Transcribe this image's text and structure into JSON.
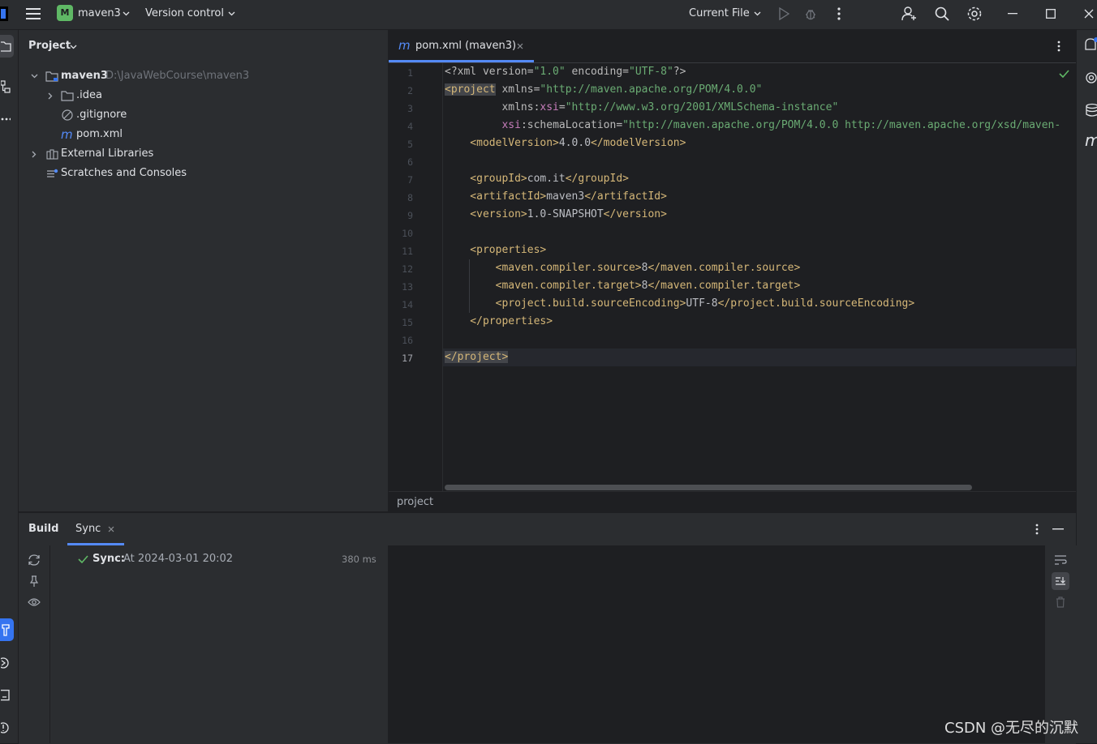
{
  "titlebar": {
    "project_badge": "M",
    "project_name": "maven3",
    "vcs_label": "Version control",
    "run_config": "Current File"
  },
  "project_panel": {
    "title": "Project",
    "tree": [
      {
        "name": "maven3",
        "path": "D:\\JavaWebCourse\\maven3"
      },
      {
        "name": ".idea"
      },
      {
        "name": ".gitignore"
      },
      {
        "name": "pom.xml"
      },
      {
        "name": "External Libraries"
      },
      {
        "name": "Scratches and Consoles"
      }
    ]
  },
  "editor": {
    "tab_label": "pom.xml (maven3)",
    "line_numbers": [
      "1",
      "2",
      "3",
      "4",
      "5",
      "6",
      "7",
      "8",
      "9",
      "10",
      "11",
      "12",
      "13",
      "14",
      "15",
      "16",
      "17"
    ],
    "breadcrumb": "project"
  },
  "build": {
    "tab_build": "Build",
    "tab_sync": "Sync",
    "sync_title": "Sync:",
    "sync_detail": "At 2024-03-01 20:02",
    "sync_time": "380 ms"
  },
  "watermark": "CSDN @无尽的沉默",
  "colors": {
    "accent": "#3574f0",
    "success": "#5fb865",
    "tag": "#d5b778",
    "string": "#6aab73",
    "namespace": "#c77dbb"
  }
}
